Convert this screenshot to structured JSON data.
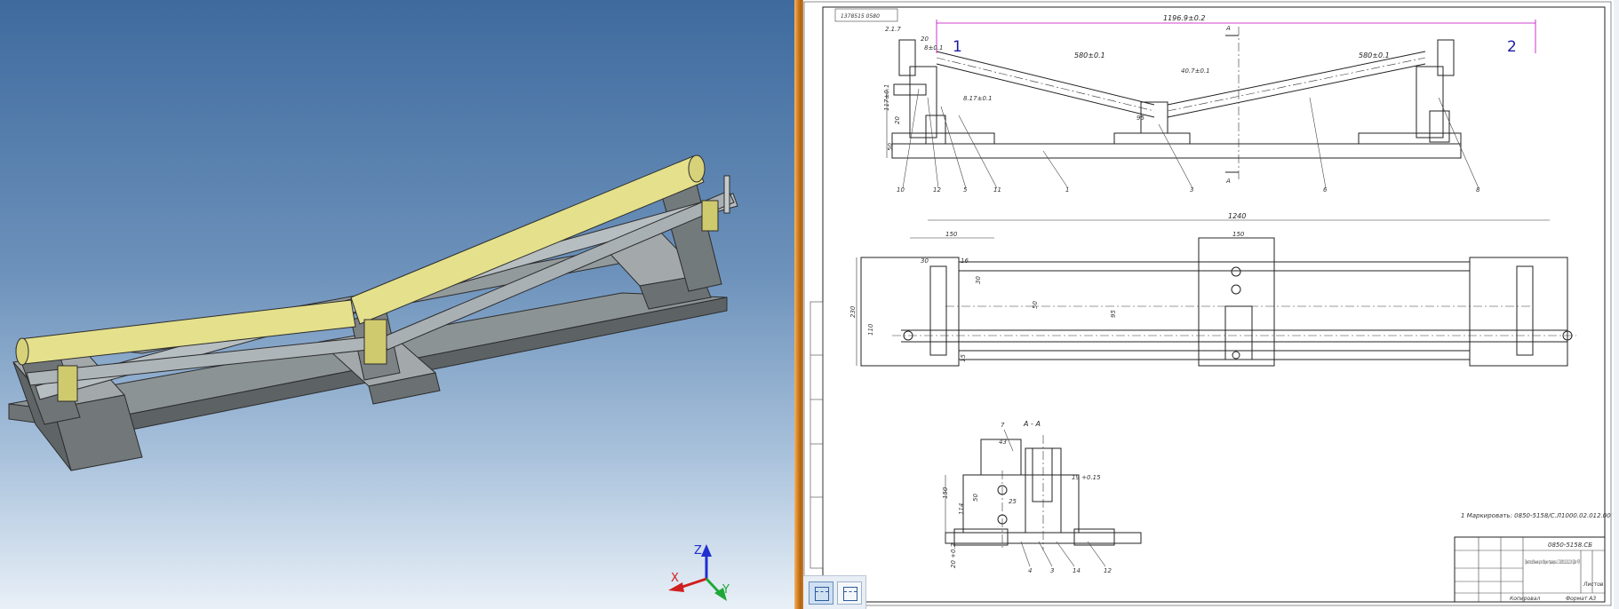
{
  "viewport3d": {
    "background_top": "#3e6a9e",
    "background_bottom": "#e9f0f7",
    "model_color": "#9aa0a2",
    "tube_color": "#e4e08c",
    "triad": {
      "z_label": "Z",
      "x_label": "X",
      "y_label": "Y",
      "z_color": "#1f2fd0",
      "x_color": "#d01f1f",
      "y_color": "#1fa83a"
    }
  },
  "drawing": {
    "doc_number_stamp": "1378515 0580",
    "callout_1": "1",
    "callout_2": "2",
    "dims_top": {
      "overall": "1196.9±0.2",
      "section_mark": "A",
      "left_small": "2.1.7",
      "offset": "20",
      "offset_tol": "8±0.1",
      "tube_left": "580±0.1",
      "tube_right": "580±0.1",
      "mid": "40.7±0.1",
      "hole": "8.17±0.1",
      "height_total": "117±0.1",
      "height_a": "20",
      "height_b": "50",
      "v_depth": "95"
    },
    "top_leaders": [
      "10",
      "12",
      "5",
      "11",
      "1",
      "3",
      "6",
      "8"
    ],
    "dims_plan": {
      "overall": "1240",
      "left_block": "150",
      "mid_block": "150",
      "a": "30",
      "b": "16",
      "c": "30",
      "d": "50",
      "e": "95",
      "height_total": "230",
      "height_b": "110",
      "bottom_small": "15"
    },
    "section": {
      "title": "A - A",
      "leader_top": "7",
      "w": "43",
      "h_total": "150",
      "h_mid": "114",
      "h_small": "50",
      "small_dim": "25",
      "bottom_dim": "20 +0.2",
      "tol": "19 +0.15",
      "leaders_bottom": [
        "4",
        "3",
        "14",
        "12"
      ]
    },
    "note": "1 Маркировать: 0850-5158/С.Л1000.02.012.00",
    "title_block": {
      "designation": "0850-5158.СБ",
      "name": "Приспособление для сборки траверсы С.Л1000.02.012.00 (Для ЧП)",
      "sheet_label": "Листов",
      "copy_label": "Копировал",
      "format_label": "Формат А3"
    }
  },
  "view_toolbar": {
    "buttons": [
      {
        "name": "single-view",
        "active": true
      },
      {
        "name": "split-view",
        "active": false
      }
    ]
  }
}
